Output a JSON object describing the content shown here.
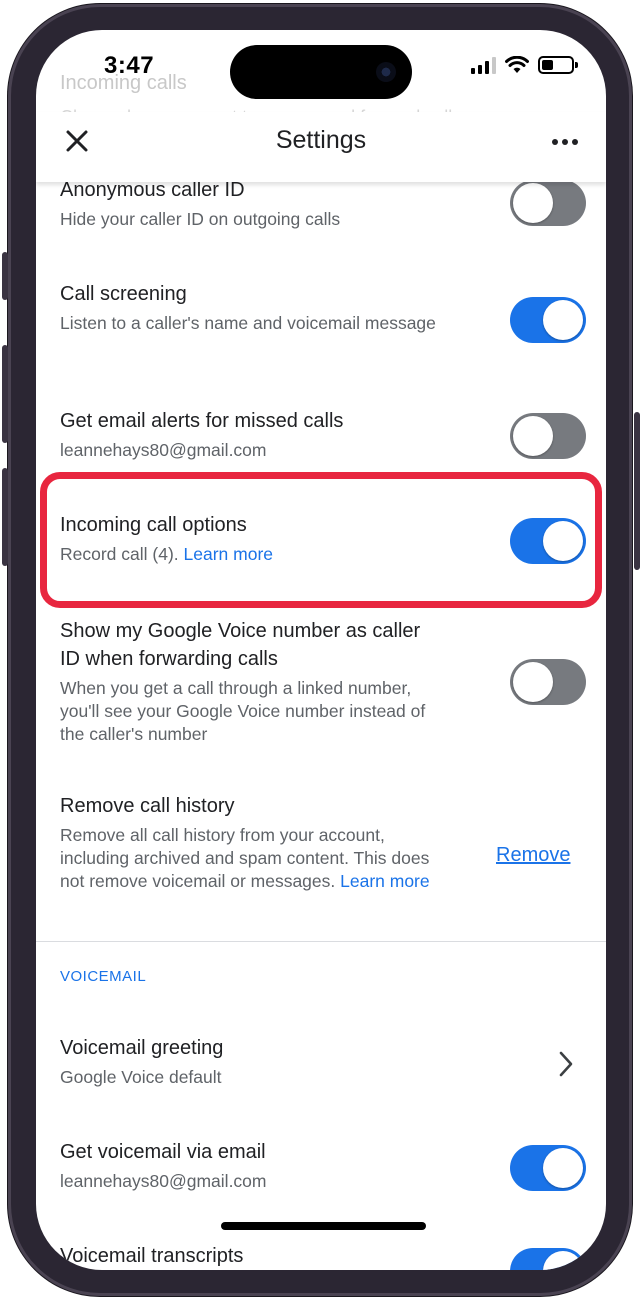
{
  "status_bar": {
    "time": "3:47"
  },
  "ghost": {
    "title": "Incoming calls",
    "subtitle": "Choose how you want to answer and forward calls"
  },
  "app_bar": {
    "title": "Settings"
  },
  "settings": [
    {
      "title": "Anonymous caller ID",
      "subtitle": "Hide your caller ID on outgoing calls",
      "enabled": false
    },
    {
      "title": "Call screening",
      "subtitle": "Listen to a caller's name and voicemail message",
      "enabled": true
    },
    {
      "title": "Get email alerts for missed calls",
      "subtitle": "leannehays80@gmail.com",
      "enabled": false
    },
    {
      "title": "Incoming call options",
      "subtitle": "Record call (4).",
      "link": "Learn more",
      "enabled": true
    },
    {
      "title": "Show my Google Voice number as caller ID when forwarding calls",
      "subtitle": "When you get a call through a linked number, you'll see your Google Voice number instead of the caller's number",
      "enabled": false
    },
    {
      "title": "Remove call history",
      "subtitle": "Remove all call history from your account, including archived and spam content. This does not remove voicemail or messages.",
      "link": "Learn more",
      "action": "Remove"
    }
  ],
  "voicemail_section": {
    "header": "VOICEMAIL",
    "items": [
      {
        "title": "Voicemail greeting",
        "subtitle": "Google Voice default"
      },
      {
        "title": "Get voicemail via email",
        "subtitle": "leannehays80@gmail.com",
        "enabled": true
      },
      {
        "title": "Voicemail transcripts",
        "enabled": true
      }
    ]
  },
  "colors": {
    "accent": "#1a73e8",
    "highlight": "#e8263f",
    "toggle_off": "#777a7f"
  }
}
